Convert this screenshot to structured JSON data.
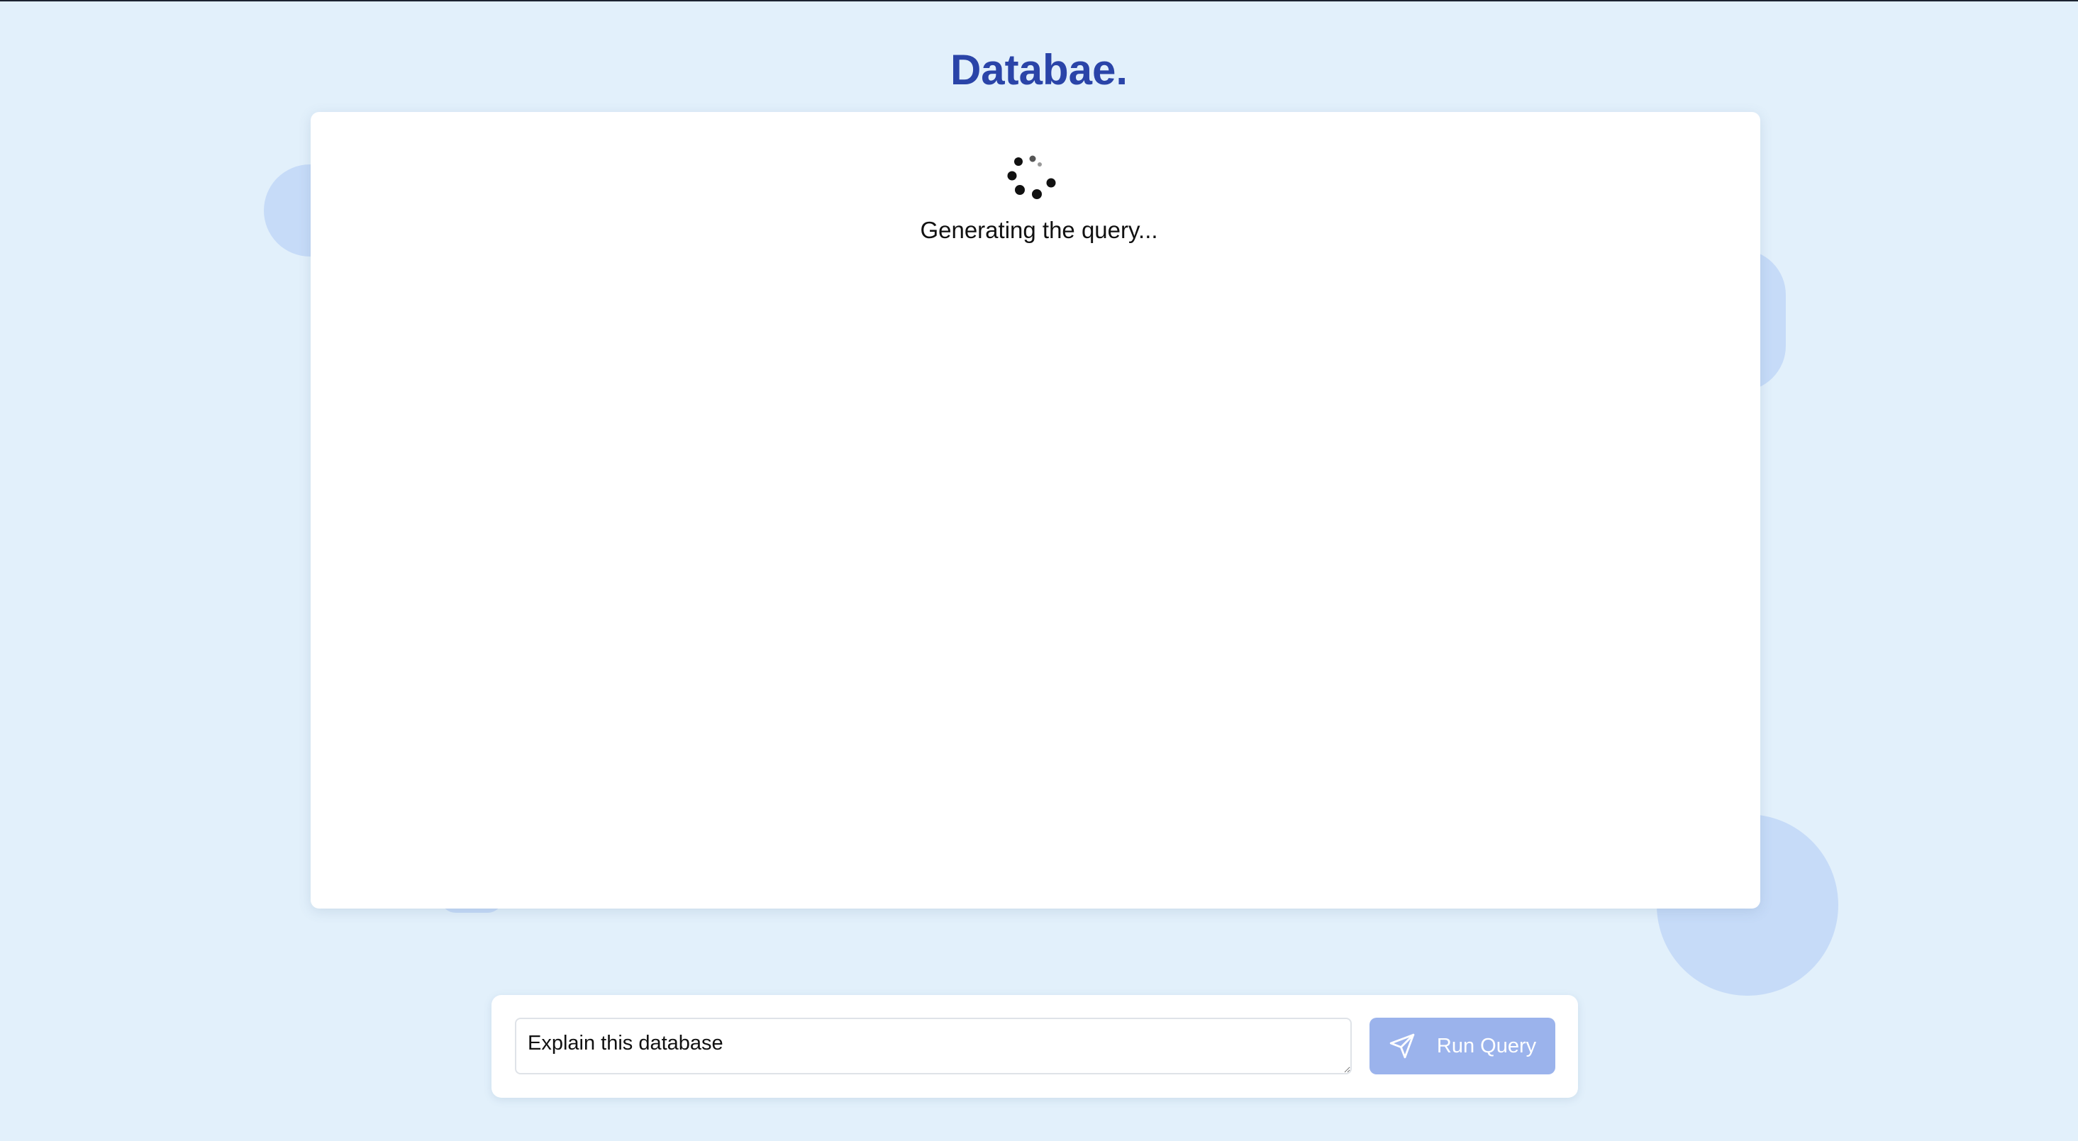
{
  "header": {
    "title": "Databae."
  },
  "panel": {
    "status_text": "Generating the query...",
    "spinner_icon": "loading-spinner-icon"
  },
  "query_bar": {
    "input_value": "Explain this database",
    "run_button_label": "Run Query",
    "run_button_icon": "send-icon"
  },
  "colors": {
    "page_background": "#e2f0fb",
    "title": "#2a44a8",
    "bubble": "#c6dbf8",
    "run_button": "#9bb3ec"
  }
}
